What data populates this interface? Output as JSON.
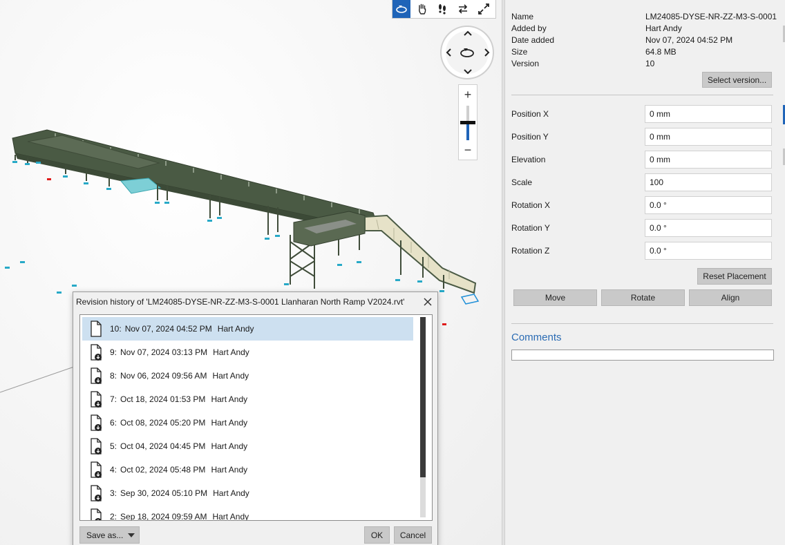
{
  "toolbar": {
    "buttons": [
      {
        "icon": "orbit-icon",
        "active": true
      },
      {
        "icon": "pan-hand-icon",
        "active": false
      },
      {
        "icon": "walk-footsteps-icon",
        "active": false
      },
      {
        "icon": "swap-arrows-icon",
        "active": false
      },
      {
        "icon": "fullscreen-icon",
        "active": false
      }
    ]
  },
  "zoom": {
    "plus": "+",
    "minus": "−"
  },
  "properties": {
    "rows": [
      {
        "label": "Name",
        "value": "LM24085-DYSE-NR-ZZ-M3-S-0001"
      },
      {
        "label": "Added by",
        "value": "Hart Andy"
      },
      {
        "label": "Date added",
        "value": "Nov 07, 2024 04:52 PM"
      },
      {
        "label": "Size",
        "value": "64.8 MB"
      },
      {
        "label": "Version",
        "value": "10"
      }
    ],
    "select_version_label": "Select version..."
  },
  "placement": {
    "fields": [
      {
        "label": "Position X",
        "value": "0 mm"
      },
      {
        "label": "Position Y",
        "value": "0 mm"
      },
      {
        "label": "Elevation",
        "value": "0 mm"
      },
      {
        "label": "Scale",
        "value": "100"
      },
      {
        "label": "Rotation X",
        "value": "0.0 °"
      },
      {
        "label": "Rotation Y",
        "value": "0.0 °"
      },
      {
        "label": "Rotation Z",
        "value": "0.0 °"
      }
    ],
    "reset_label": "Reset Placement",
    "move_label": "Move",
    "rotate_label": "Rotate",
    "align_label": "Align"
  },
  "comments": {
    "title": "Comments"
  },
  "dialog": {
    "title": "Revision history of 'LM24085-DYSE-NR-ZZ-M3-S-0001 Llanharan North Ramp V2024.rvt'",
    "revisions": [
      {
        "num": "10:",
        "date": "Nov 07, 2024 04:52 PM",
        "user": "Hart Andy",
        "selected": true,
        "icon": "document-icon"
      },
      {
        "num": "9:",
        "date": "Nov 07, 2024 03:13 PM",
        "user": "Hart Andy",
        "selected": false,
        "icon": "document-download-icon"
      },
      {
        "num": "8:",
        "date": "Nov 06, 2024 09:56 AM",
        "user": "Hart Andy",
        "selected": false,
        "icon": "document-download-icon"
      },
      {
        "num": "7:",
        "date": "Oct 18, 2024 01:53 PM",
        "user": "Hart Andy",
        "selected": false,
        "icon": "document-download-icon"
      },
      {
        "num": "6:",
        "date": "Oct 08, 2024 05:20 PM",
        "user": "Hart Andy",
        "selected": false,
        "icon": "document-download-icon"
      },
      {
        "num": "5:",
        "date": "Oct 04, 2024 04:45 PM",
        "user": "Hart Andy",
        "selected": false,
        "icon": "document-download-icon"
      },
      {
        "num": "4:",
        "date": "Oct 02, 2024 05:48 PM",
        "user": "Hart Andy",
        "selected": false,
        "icon": "document-download-icon"
      },
      {
        "num": "3:",
        "date": "Sep 30, 2024 05:10 PM",
        "user": "Hart Andy",
        "selected": false,
        "icon": "document-download-icon"
      },
      {
        "num": "2:",
        "date": "Sep 18, 2024 09:59 AM",
        "user": "Hart Andy",
        "selected": false,
        "icon": "document-download-icon"
      }
    ],
    "save_as_label": "Save as...",
    "ok_label": "OK",
    "cancel_label": "Cancel"
  },
  "colors": {
    "accent": "#1f64b8",
    "structure": "#4a5a44",
    "selection": "#cde0f0",
    "comments_title": "#2a6bb3"
  }
}
